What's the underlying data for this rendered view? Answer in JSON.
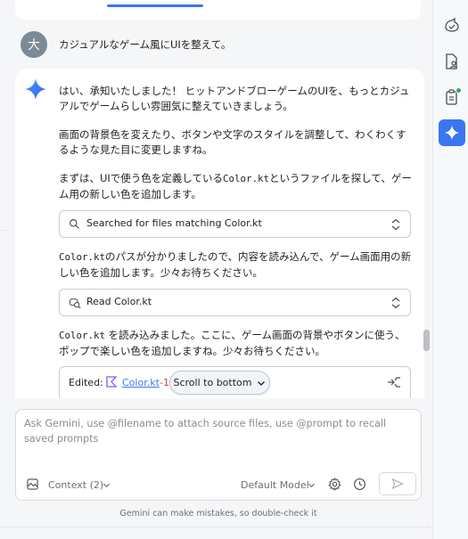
{
  "user": {
    "avatar_initial": "大",
    "message": "カジュアルなゲーム風にUIを整えて。"
  },
  "response": {
    "paragraphs": [
      "はい、承知いたしました！ ヒットアンドブローゲームのUIを、もっとカジュアルでゲームらしい雰囲気に整えていきましょう。",
      "画面の背景色を変えたり、ボタンや文字のスタイルを調整して、わくわくするような見た目に変更しますね。"
    ],
    "para3_prefix": "まずは、UIで使う色を定義している",
    "para3_code": "Color.kt",
    "para3_suffix": "というファイルを探して、ゲーム用の新しい色を追加します。",
    "tool1_label": "Searched for files matching Color.kt",
    "para4_code": "Color.kt",
    "para4_suffix": "のパスが分かりましたので、内容を読み込んで、ゲーム画面用の新しい色を追加します。少々お待ちください。",
    "tool2_label": "Read Color.kt",
    "para5_code": "Color.kt",
    "para5_suffix": " を読み込みました。ここに、ゲーム画面の背景やボタンに使う、ポップで楽しい色を追加しますね。少々お待ちください。",
    "edit_label": "Edited:",
    "edit_file": "Color.kt",
    "edit_count": "-1",
    "scroll_bottom_label": "Scroll to bottom"
  },
  "input": {
    "placeholder": "Ask Gemini, use @filename to attach source files, use @prompt to recall saved prompts",
    "context_label": "Context (2)",
    "model_label": "Default Model"
  },
  "footer": {
    "disclaimer": "Gemini can make mistakes, so double-check it"
  },
  "colors": {
    "accent": "#3a76f0",
    "removed": "#d0413a",
    "status_dot": "#29a86a"
  },
  "icons": [
    "gemini-star-icon",
    "search-icon",
    "chevron-updown-icon",
    "read-file-icon",
    "kotlin-file-icon",
    "merge-icon",
    "chevron-down-icon",
    "image-attach-icon",
    "gear-icon",
    "history-icon",
    "send-icon",
    "agent-icon",
    "file-person-icon",
    "clipboard-icon"
  ]
}
